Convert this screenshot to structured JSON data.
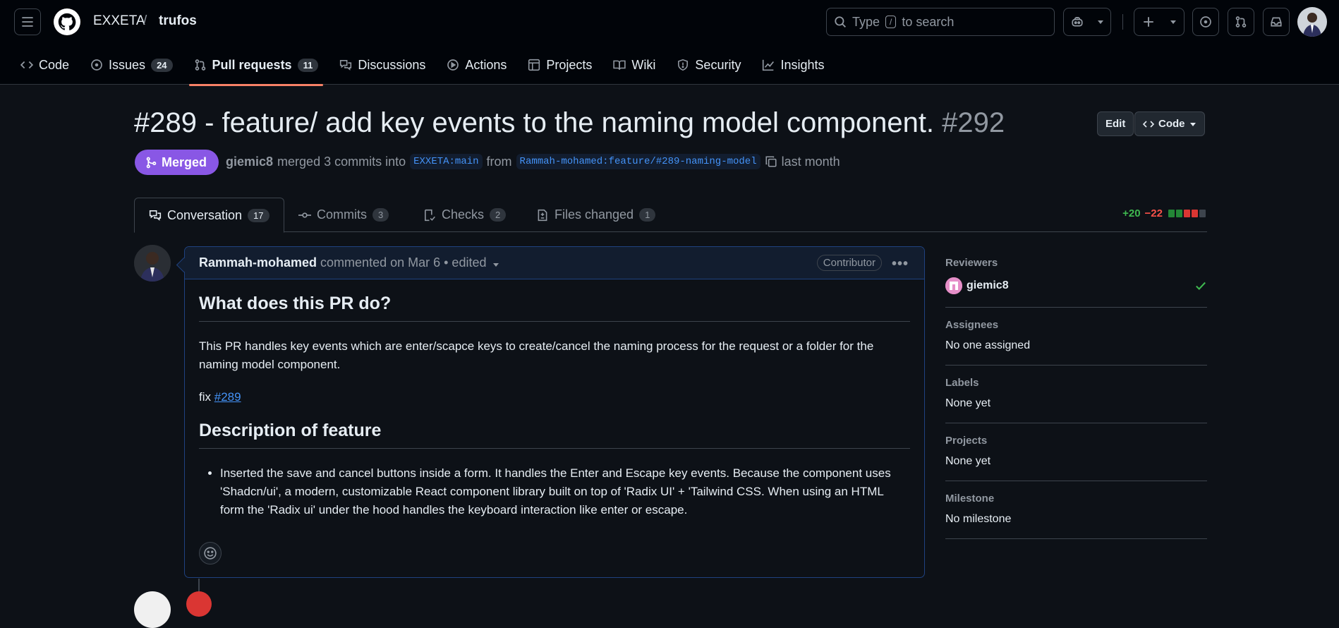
{
  "header": {
    "owner": "EXXETA",
    "separator": "/",
    "repo": "trufos",
    "search_prefix": "Type",
    "search_key": "/",
    "search_suffix": "to search"
  },
  "repo_nav": [
    {
      "label": "Code",
      "count": null
    },
    {
      "label": "Issues",
      "count": "24"
    },
    {
      "label": "Pull requests",
      "count": "11"
    },
    {
      "label": "Discussions",
      "count": null
    },
    {
      "label": "Actions",
      "count": null
    },
    {
      "label": "Projects",
      "count": null
    },
    {
      "label": "Wiki",
      "count": null
    },
    {
      "label": "Security",
      "count": null
    },
    {
      "label": "Insights",
      "count": null
    }
  ],
  "pr": {
    "title": "#289 - feature/ add key events to the naming model component.",
    "number": "#292",
    "edit_label": "Edit",
    "code_label": "Code",
    "state": "Merged",
    "merger": "giemic8",
    "merge_text": "merged 3 commits into",
    "base": "EXXETA:main",
    "from_text": "from",
    "head": "Rammah-mohamed:feature/#289-naming-model",
    "when": "last month"
  },
  "tabs": [
    {
      "label": "Conversation",
      "count": "17"
    },
    {
      "label": "Commits",
      "count": "3"
    },
    {
      "label": "Checks",
      "count": "2"
    },
    {
      "label": "Files changed",
      "count": "1"
    }
  ],
  "diffstat": {
    "additions": "+20",
    "deletions": "−22",
    "colors": [
      "#238636",
      "#238636",
      "#da3633",
      "#da3633",
      "#3d444d"
    ]
  },
  "comment": {
    "author": "Rammah-mohamed",
    "action": "commented on Mar 6",
    "edited": "• edited",
    "role": "Contributor",
    "heading1": "What does this PR do?",
    "para1": "This PR handles key events which are enter/scapce keys to create/cancel the naming process for the request or a folder for the naming model component.",
    "fix_label": "fix",
    "fix_link": "#289",
    "heading2": "Description of feature",
    "bullet1": "Inserted the save and cancel buttons inside a form. It handles the Enter and Escape key events. Because the component uses 'Shadcn/ui', a modern, customizable React component library built on top of 'Radix UI' + 'Tailwind CSS. When using an HTML form the 'Radix ui' under the hood handles the keyboard interaction like enter or escape."
  },
  "sidebar": {
    "reviewers_label": "Reviewers",
    "reviewer": "giemic8",
    "assignees_label": "Assignees",
    "assignees_value": "No one assigned",
    "labels_label": "Labels",
    "labels_value": "None yet",
    "projects_label": "Projects",
    "projects_value": "None yet",
    "milestone_label": "Milestone",
    "milestone_value": "No milestone"
  },
  "colors": {
    "accent": "#f78166",
    "merged": "#8957e5",
    "link": "#4493f8",
    "check": "#3fb950"
  }
}
